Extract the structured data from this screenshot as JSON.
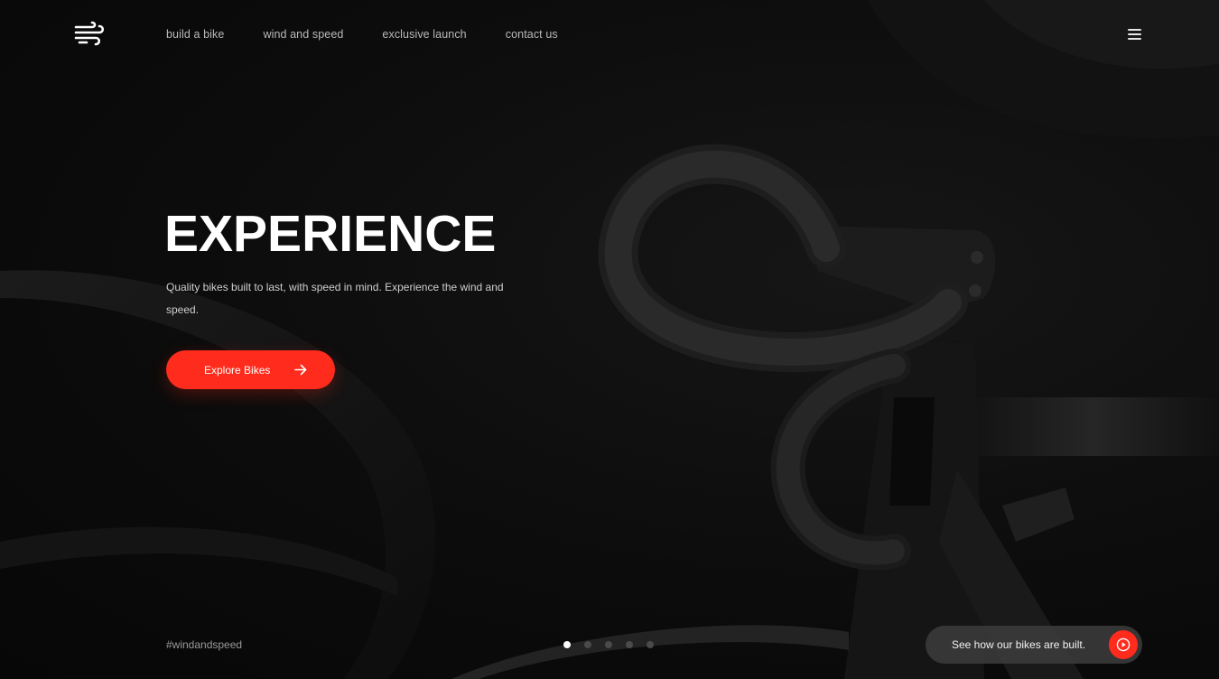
{
  "nav": {
    "links": [
      "build a bike",
      "wind and speed",
      "exclusive launch",
      "contact us"
    ]
  },
  "hero": {
    "title": "EXPERIENCE",
    "description": "Quality bikes built to last, with speed in mind. Experience the wind and speed.",
    "cta_label": "Explore Bikes"
  },
  "footer": {
    "hashtag": "#windandspeed",
    "video_label": "See how our bikes are built.",
    "slider": {
      "total": 5,
      "active": 1
    }
  },
  "colors": {
    "accent": "#ff2b1c",
    "background": "#0b0b0b"
  },
  "icons": {
    "logo": "wind-logo-icon",
    "menu": "hamburger-menu-icon",
    "cta": "arrow-right-icon",
    "video": "play-circle-icon"
  }
}
